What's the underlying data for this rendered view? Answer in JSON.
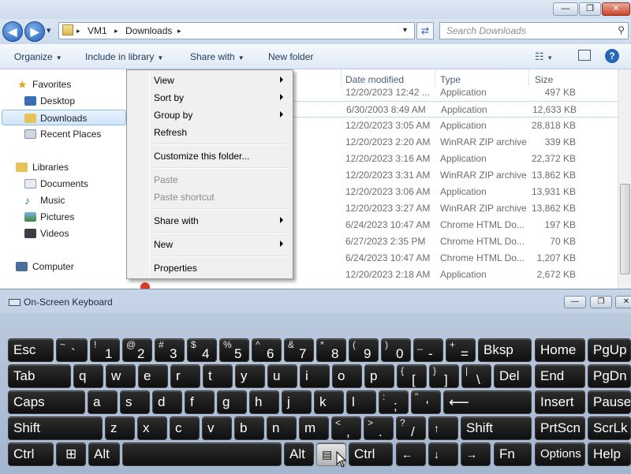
{
  "explorer": {
    "window_controls": {
      "minimize": "—",
      "maximize": "❐",
      "close": "✕"
    },
    "nav": {
      "back": "◀",
      "forward": "▶",
      "recent": "▾"
    },
    "breadcrumb": {
      "root": "VM1",
      "folder": "Downloads",
      "sep": "▸"
    },
    "search_placeholder": "Search Downloads",
    "toolbar": {
      "organize": "Organize",
      "include": "Include in library",
      "share": "Share with",
      "new_folder": "New folder"
    },
    "nav_pane": {
      "favorites": "Favorites",
      "desktop": "Desktop",
      "downloads": "Downloads",
      "recent_places": "Recent Places",
      "libraries": "Libraries",
      "documents": "Documents",
      "music": "Music",
      "pictures": "Pictures",
      "videos": "Videos",
      "computer": "Computer"
    },
    "columns": {
      "date": "Date modified",
      "type": "Type",
      "size": "Size"
    },
    "files": [
      {
        "date": "12/20/2023 12:42 ...",
        "type": "Application",
        "size": "497 KB"
      },
      {
        "date": "6/30/2003 8:49 AM",
        "type": "Application",
        "size": "12,633 KB"
      },
      {
        "date": "12/20/2023 3:05 AM",
        "type": "Application",
        "size": "28,818 KB"
      },
      {
        "date": "12/20/2023 2:20 AM",
        "type": "WinRAR ZIP archive",
        "size": "339 KB"
      },
      {
        "date": "12/20/2023 3:16 AM",
        "type": "Application",
        "size": "22,372 KB"
      },
      {
        "date": "12/20/2023 3:31 AM",
        "type": "WinRAR ZIP archive",
        "size": "13,862 KB"
      },
      {
        "date": "12/20/2023 3:06 AM",
        "type": "Application",
        "size": "13,931 KB"
      },
      {
        "date": "12/20/2023 3:27 AM",
        "type": "WinRAR ZIP archive",
        "size": "13,862 KB"
      },
      {
        "date": "6/24/2023 10:47 AM",
        "type": "Chrome HTML Do...",
        "size": "197 KB"
      },
      {
        "date": "6/27/2023 2:35 PM",
        "type": "Chrome HTML Do...",
        "size": "70 KB"
      },
      {
        "date": "6/24/2023 10:47 AM",
        "type": "Chrome HTML Do...",
        "size": "1,207 KB"
      },
      {
        "date": "12/20/2023 2:18 AM",
        "type": "Application",
        "size": "2,672 KB"
      }
    ]
  },
  "context_menu": {
    "view": "View",
    "sort_by": "Sort by",
    "group_by": "Group by",
    "refresh": "Refresh",
    "customize": "Customize this folder...",
    "paste": "Paste",
    "paste_shortcut": "Paste shortcut",
    "share_with": "Share with",
    "new": "New",
    "properties": "Properties"
  },
  "osk": {
    "title": "On-Screen Keyboard",
    "controls": {
      "minimize": "—",
      "restore": "❐",
      "close": "✕"
    },
    "keys": {
      "esc": "Esc",
      "tilde_s": "~",
      "tilde_b": "`",
      "k1_s": "!",
      "k1_b": "1",
      "k2_s": "@",
      "k2_b": "2",
      "k3_s": "#",
      "k3_b": "3",
      "k4_s": "$",
      "k4_b": "4",
      "k5_s": "%",
      "k5_b": "5",
      "k6_s": "^",
      "k6_b": "6",
      "k7_s": "&",
      "k7_b": "7",
      "k8_s": "*",
      "k8_b": "8",
      "k9_s": "(",
      "k9_b": "9",
      "k0_s": ")",
      "k0_b": "0",
      "minus_s": "_",
      "minus_b": "-",
      "equal_s": "+",
      "equal_b": "=",
      "bksp": "Bksp",
      "home": "Home",
      "pgup": "PgUp",
      "tab": "Tab",
      "q": "q",
      "w": "w",
      "e": "e",
      "r": "r",
      "t": "t",
      "y": "y",
      "u": "u",
      "i": "i",
      "o": "o",
      "p": "p",
      "lbr_s": "{",
      "lbr_b": "[",
      "rbr_s": "}",
      "rbr_b": "]",
      "bsl_s": "|",
      "bsl_b": "\\",
      "del": "Del",
      "end": "End",
      "pgdn": "PgDn",
      "caps": "Caps",
      "a": "a",
      "s": "s",
      "d": "d",
      "f": "f",
      "g": "g",
      "h": "h",
      "j": "j",
      "k": "k",
      "l": "l",
      "semi_s": ":",
      "semi_b": ";",
      "quote_s": "\"",
      "quote_b": "'",
      "enter": "⟵",
      "insert": "Insert",
      "pause": "Pause",
      "shift": "Shift",
      "z": "z",
      "x": "x",
      "c": "c",
      "v": "v",
      "b": "b",
      "n": "n",
      "m": "m",
      "comma_s": "<",
      "comma_b": ",",
      "period_s": ">",
      "period_b": ".",
      "slash_s": "?",
      "slash_b": "/",
      "up": "↑",
      "shift_r": "Shift",
      "prtscn": "PrtScn",
      "scrlk": "ScrLk",
      "ctrl": "Ctrl",
      "win": "⊞",
      "alt": "Alt",
      "space": "",
      "alt_r": "Alt",
      "menu": "▤",
      "ctrl_r": "Ctrl",
      "left": "←",
      "down": "↓",
      "right": "→",
      "fn": "Fn",
      "options": "Options",
      "help": "Help"
    }
  }
}
